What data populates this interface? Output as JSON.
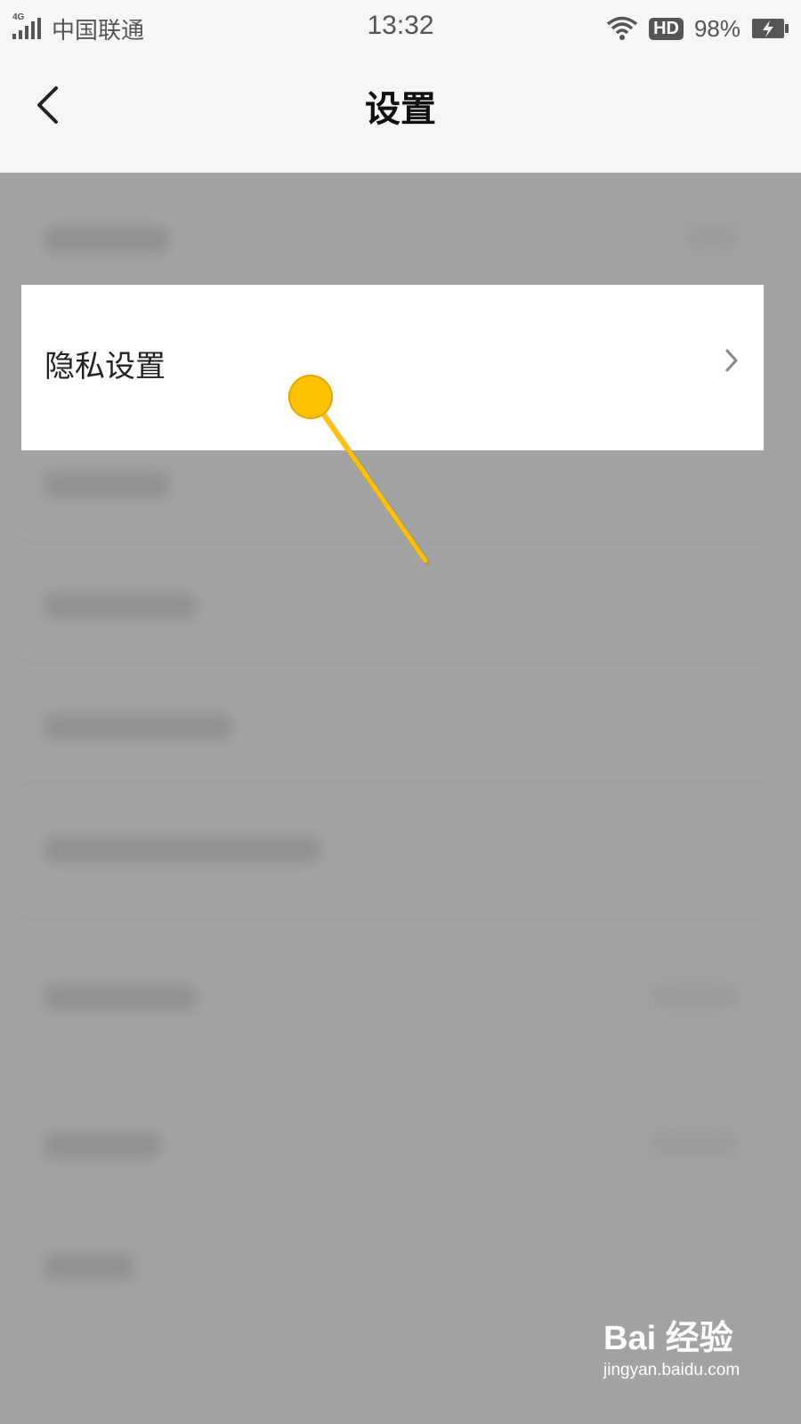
{
  "status_bar": {
    "network": "4G",
    "carrier": "中国联通",
    "time": "13:32",
    "hd": "HD",
    "battery": "98%"
  },
  "nav": {
    "title": "设置"
  },
  "highlighted_item": {
    "label": "隐私设置"
  },
  "watermark": {
    "brand": "Bai  经验",
    "url": "jingyan.baidu.com"
  },
  "colors": {
    "pointer": "#ffc200",
    "overlay": "#a3a3a3"
  }
}
